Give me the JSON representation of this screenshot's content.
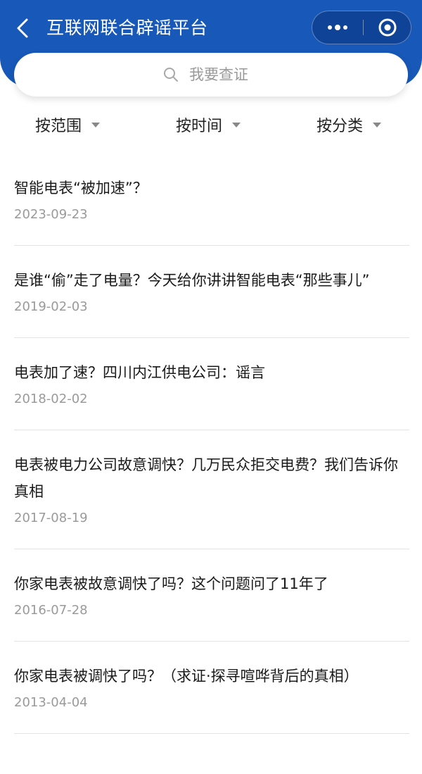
{
  "header": {
    "title": "互联网联合辟谣平台"
  },
  "search": {
    "placeholder": "我要查证"
  },
  "filters": [
    {
      "label": "按范围"
    },
    {
      "label": "按时间"
    },
    {
      "label": "按分类"
    }
  ],
  "articles": [
    {
      "title": "智能电表“被加速”？",
      "date": "2023-09-23"
    },
    {
      "title": "是谁“偷”走了电量？今天给你讲讲智能电表“那些事儿”",
      "date": "2019-02-03"
    },
    {
      "title": "电表加了速？四川内江供电公司：谣言",
      "date": "2018-02-02"
    },
    {
      "title": "电表被电力公司故意调快？几万民众拒交电费？我们告诉你真相",
      "date": "2017-08-19"
    },
    {
      "title": "你家电表被故意调快了吗？这个问题问了11年了",
      "date": "2016-07-28"
    },
    {
      "title": "你家电表被调快了吗？（求证·探寻喧哗背后的真相）",
      "date": "2013-04-04"
    }
  ],
  "colors": {
    "header_bg": "#1758b8",
    "date_text": "#9a9a9a"
  }
}
